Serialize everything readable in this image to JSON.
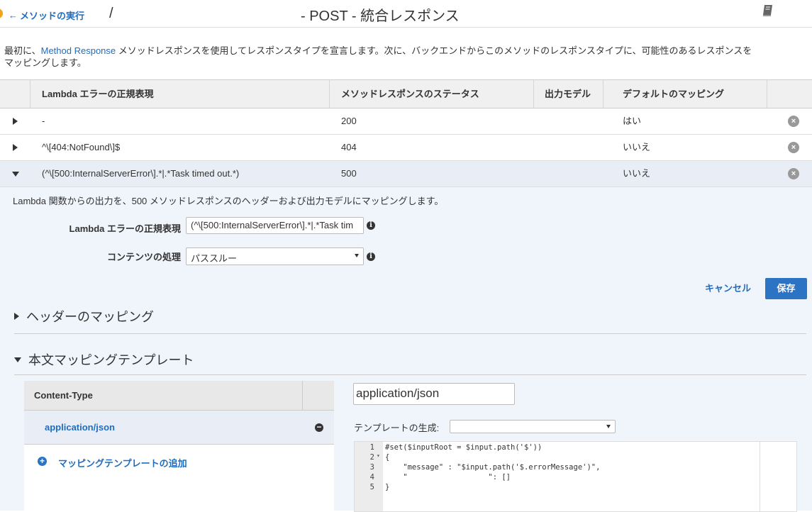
{
  "header": {
    "back_label": "メソッドの実行",
    "separator": "/",
    "title": "- POST - 統合レスポンス"
  },
  "intro": {
    "part1": "最初に、",
    "link": "Method Response",
    "part2": " メソッドレスポンスを使用してレスポンスタイプを宣言します。次に、バックエンドからこのメソッドのレスポンスタイプに、可能性のあるレスポンスを",
    "line2": "マッピングします。"
  },
  "table": {
    "columns": [
      "Lambda エラーの正規表現",
      "メソッドレスポンスのステータス",
      "出力モデル",
      "デフォルトのマッピング"
    ],
    "rows": [
      {
        "regex": "-",
        "status": "200",
        "model": "",
        "default": "はい"
      },
      {
        "regex": "^\\[404:NotFound\\]$",
        "status": "404",
        "model": "",
        "default": "いいえ"
      },
      {
        "regex": "(^\\[500:InternalServerError\\].*|.*Task timed out.*)",
        "status": "500",
        "model": "",
        "default": "いいえ"
      }
    ]
  },
  "detail": {
    "description": "Lambda 関数からの出力を、500 メソッドレスポンスのヘッダーおよび出力モデルにマッピングします。",
    "regex_label": "Lambda エラーの正規表現",
    "regex_value": "(^\\[500:InternalServerError\\].*|.*Task tim",
    "content_label": "コンテンツの処理",
    "content_value": "パススルー",
    "cancel_label": "キャンセル",
    "save_label": "保存"
  },
  "sections": {
    "header_mapping": "ヘッダーのマッピング",
    "body_mapping": "本文マッピングテンプレート"
  },
  "content_types": {
    "header": "Content-Type",
    "selected": "application/json",
    "add_label": "マッピングテンプレートの追加"
  },
  "template": {
    "content_type_value": "application/json",
    "generate_label": "テンプレートの生成:",
    "generate_value": "",
    "lines": [
      {
        "n": "1",
        "text": "#set($inputRoot = $input.path('$'))"
      },
      {
        "n": "2",
        "text": "{"
      },
      {
        "n": "3",
        "text": "    \"message\" : \"$input.path('$.errorMessage')\","
      },
      {
        "n": "4",
        "text": "    \"                  \": []"
      },
      {
        "n": "5",
        "text": "}"
      }
    ]
  },
  "colors": {
    "accent": "#1f6dbf",
    "button": "#2d73c4",
    "selected_row": "#e9eef6",
    "detail_bg": "#f0f5fb"
  }
}
